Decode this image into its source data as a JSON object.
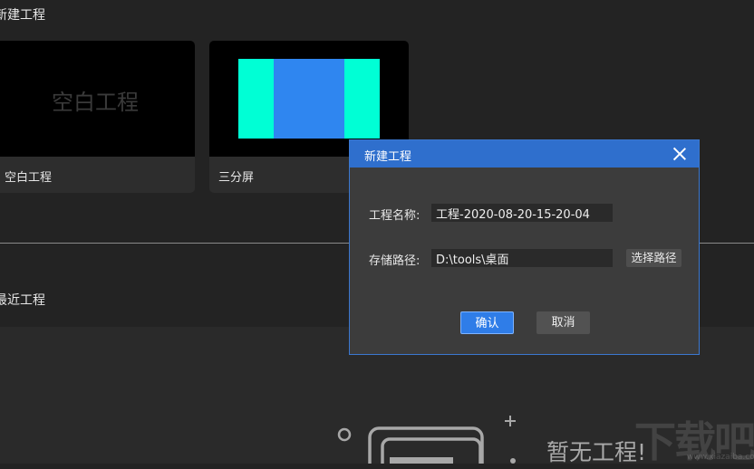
{
  "sections": {
    "new_project": "新建工程",
    "recent_projects": "最近工程"
  },
  "templates": [
    {
      "label": "空白工程",
      "preview_text": "空白工程"
    },
    {
      "label": "三分屏",
      "preview_colors": [
        "#00ffd5",
        "#2f86f0",
        "#00ffd5"
      ]
    }
  ],
  "dialog": {
    "title": "新建工程",
    "name_label": "工程名称:",
    "name_value": "工程-2020-08-20-15-20-04",
    "path_label": "存储路径:",
    "path_value": "D:\\tools\\桌面",
    "browse_label": "选择路径",
    "confirm_label": "确认",
    "cancel_label": "取消",
    "accent_color": "#2f6fcd"
  },
  "empty_state": {
    "text": "暂无工程!",
    "icon": "empty-folder-icon"
  },
  "watermark": {
    "text": "下载吧",
    "url": "www.xiazaiba.com"
  }
}
